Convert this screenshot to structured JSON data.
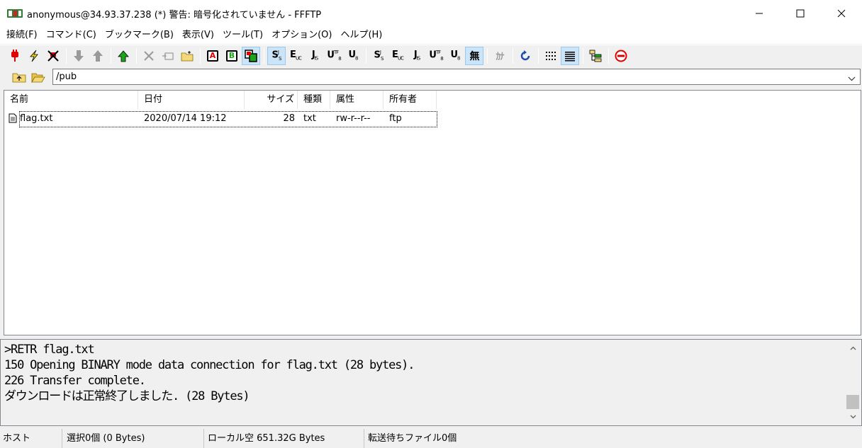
{
  "window": {
    "title": "anonymous@34.93.37.238 (*) 警告: 暗号化されていません - FFFTP",
    "minimize": "—",
    "maximize": "☐",
    "close": "✕"
  },
  "menu": [
    "接続(F)",
    "コマンド(C)",
    "ブックマーク(B)",
    "表示(V)",
    "ツール(T)",
    "オプション(O)",
    "ヘルプ(H)"
  ],
  "toolbar": {
    "ascii_label": "A",
    "binary_label": "B",
    "kanji_none_label": "無",
    "kana_label": "ｶﾅ"
  },
  "path": {
    "value": "/pub"
  },
  "filelist": {
    "headers": [
      "名前",
      "日付",
      "サイズ",
      "種類",
      "属性",
      "所有者"
    ],
    "rows": [
      {
        "name": "flag.txt",
        "date": "2020/07/14 19:12",
        "size": "28",
        "type": "txt",
        "attr": "rw-r--r--",
        "owner": "ftp"
      }
    ]
  },
  "log": [
    ">RETR flag.txt",
    "150 Opening BINARY mode data connection for flag.txt (28 bytes).",
    "226 Transfer complete.",
    "ダウンロードは正常終了しました. (28 Bytes)"
  ],
  "status": {
    "host": "ホスト",
    "selection": "選択0個 (0 Bytes)",
    "local_free": "ローカル空 651.32G Bytes",
    "queue": "転送待ちファイル0個"
  },
  "colors": {
    "accent_active": "#cce4f7",
    "green_arrow": "#1aa51a",
    "red_plug": "#e00000"
  }
}
